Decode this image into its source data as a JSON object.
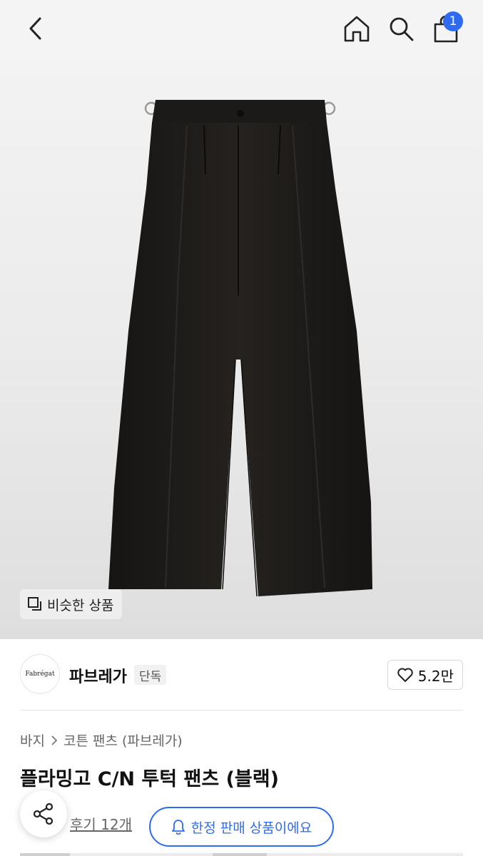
{
  "header": {
    "cart_count": "1",
    "icons": [
      "back-icon",
      "home-icon",
      "search-icon",
      "bag-icon"
    ]
  },
  "hero": {
    "similar_label": "비슷한 상품",
    "similar_icon": "copy-icon"
  },
  "brand": {
    "logo_text": "Fabrégat",
    "name": "파브레가",
    "badge": "단독",
    "likes": "5.2만",
    "like_icon": "heart-icon"
  },
  "breadcrumb": {
    "items": [
      "바지",
      "코튼 팬츠 (파브레가)"
    ],
    "separator_icon": "chevron-right-icon"
  },
  "product": {
    "title": "플라밍고 C/N 투턱 팬츠 (블랙)",
    "reviews": "후기 12개"
  },
  "actions": {
    "limited_label": "한정 판매 상품이에요",
    "limited_icon": "bell-icon",
    "share_icon": "share-icon"
  },
  "colors": {
    "accent": "#2f6bf0",
    "pants": "#1e1c1a"
  }
}
